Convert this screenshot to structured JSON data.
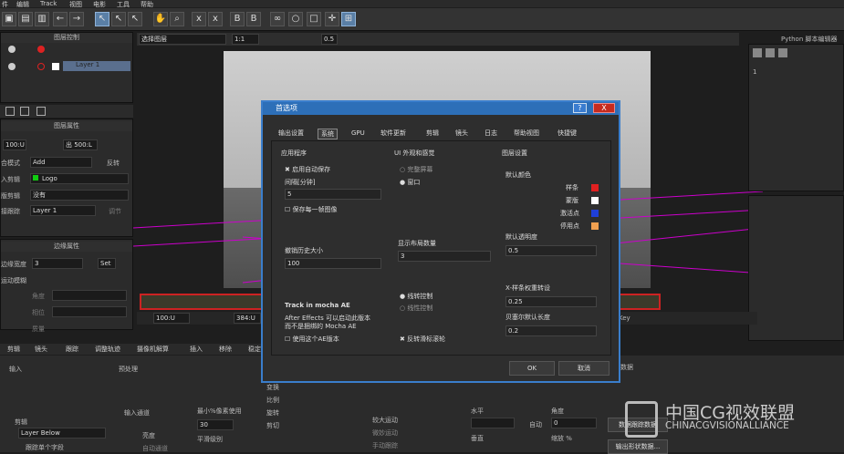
{
  "menu": {
    "items": [
      "件",
      "编辑",
      "Track",
      "视图",
      "电影",
      "工具",
      "帮助"
    ]
  },
  "toolbar": {
    "view_select": "选择图层",
    "zoom": "1:1",
    "opacity": "0.5",
    "python_label": "Python 脚本编辑器"
  },
  "left": {
    "layer_controls_title": "图层控制",
    "layer_name": "Layer 1",
    "layer_props_title": "图层属性",
    "in_label": "100:U",
    "out_label": "出 500:L",
    "blend_label": "合模式",
    "blend_value": "Add",
    "invert_label": "反转",
    "input_clip_label": "入剪辑",
    "input_clip_value": "Logo",
    "matte_label": "版剪辑",
    "matte_value": "没有",
    "link_label": "接跟踪",
    "link_value": "Layer 1",
    "link_extra": "调节",
    "edge_props_title": "边缘属性",
    "edge_width_label": "边缘宽度",
    "edge_width_value": "3",
    "edge_set": "Set",
    "motion_blur_label": "运动模糊",
    "angle_label": "角度",
    "phase_label": "相位",
    "quality_label": "质量"
  },
  "timeline": {
    "in": "100:U",
    "out": "384:U",
    "key_label": "Key"
  },
  "bottom_tabs": [
    "剪辑",
    "镜头",
    "跟踪",
    "调整轨迹",
    "摄像机解算",
    "插入",
    "移除",
    "稳定"
  ],
  "bottom": {
    "input_label": "输入",
    "preprocess_label": "预处理",
    "clip_label": "剪辑",
    "clip_value": "Layer Below",
    "track_single": "跟踪单个字段",
    "input_channel": "输入通道",
    "luminance": "亮度",
    "auto_channel": "自动通道",
    "min_pixels": "最小%像素使用",
    "min_pixels_value": "30",
    "smooth": "平滑级别",
    "opts": [
      "变换",
      "比例",
      "旋转",
      "剪切"
    ],
    "motion_opts": [
      "较大运动",
      "微妙运动",
      "手动跟踪"
    ],
    "horizontal": "水平",
    "vertical": "垂直",
    "angle": "角度",
    "auto": "自动",
    "angle_value": "0",
    "zoom": "缩放 %",
    "data_btn1": "数据跟踪数据",
    "data_btn2": "输出形状数据...",
    "data_label": "数据"
  },
  "dialog": {
    "title": "首选项",
    "help": "?",
    "close": "X",
    "tabs": [
      "输出设置",
      "系统",
      "GPU",
      "软件更新",
      "剪辑",
      "镜头",
      "日志",
      "帮助视图",
      "快捷键"
    ],
    "app_title": "应用程序",
    "autosave": "启用自动保存",
    "interval_label": "间隔[分钟]",
    "interval_value": "5",
    "save_each": "保存每一帧图像",
    "undo_label": "撤销历史大小",
    "undo_value": "100",
    "track_ae_title": "Track in mocha AE",
    "track_ae_desc1": "After Effects 可以启动此版本",
    "track_ae_desc2": "而不是捆绑的 Mocha AE",
    "use_ae": "使用这个AE版本",
    "ui_title": "UI 外观和感觉",
    "fullscreen": "完整屏幕",
    "window": "窗口",
    "layout_label": "显示布局数量",
    "layout_value": "3",
    "linear_ctrl": "线转控制",
    "linear_ctrl2": "线性控制",
    "invert_wheel": "反转滑标滚轮",
    "layer_title": "图层设置",
    "default_color": "默认颜色",
    "colors": [
      {
        "name": "样条",
        "hex": "#e02020"
      },
      {
        "name": "蒙版",
        "hex": "#ffffff"
      },
      {
        "name": "激活点",
        "hex": "#1f3fd8"
      },
      {
        "name": "停用点",
        "hex": "#f0a050"
      }
    ],
    "opacity_label": "默认透明度",
    "opacity_value": "0.5",
    "xspline_label": "X-样条权重转设",
    "xspline_value": "0.25",
    "bezier_label": "贝塞尔默认长度",
    "bezier_value": "0.2",
    "ok": "OK",
    "cancel": "取消"
  },
  "watermark": {
    "cn": "中国CG视效联盟",
    "en": "CHINACGVISIONALLIANCE"
  }
}
